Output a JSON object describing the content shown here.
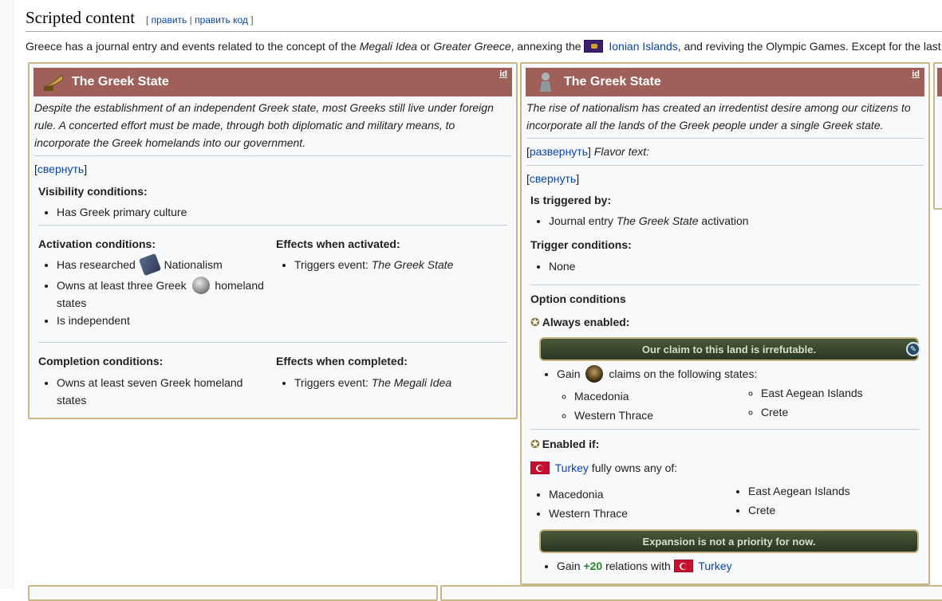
{
  "heading": {
    "title": "Scripted content",
    "edit": "править",
    "edit_code": "править код"
  },
  "intro": {
    "before": "Greece has a journal entry and events related to the concept of the ",
    "megali": "Megali Idea",
    "or": " or ",
    "greater": "Greater Greece",
    "annex": ", annexing the ",
    "ionian": "Ionian Islands",
    "after": ", and reviving the Olympic Games. Except for the last,"
  },
  "panel1": {
    "title": "The Greek State",
    "id": "id",
    "desc": "Despite the establishment of an independent Greek state, most Greeks still live under foreign rule. A concerted effort must be made, through both diplomatic and military means, to incorporate the Greek homelands into our government.",
    "collapse": "свернуть",
    "visibility_h": "Visibility conditions:",
    "visibility_items": [
      "Has Greek primary culture"
    ],
    "activation_h": "Activation conditions:",
    "act_research": "Has researched",
    "act_research_tech": "Nationalism",
    "act_owns_a": "Owns at least three Greek",
    "act_owns_b": "homeland",
    "act_owns_c": "states",
    "act_indep": "Is independent",
    "effects_act_h": "Effects when activated:",
    "effects_act_prefix": "Triggers event: ",
    "effects_act_event": "The Greek State",
    "completion_h": "Completion conditions:",
    "completion_a": "Owns at least seven Greek homeland",
    "completion_b": "states",
    "effects_comp_h": "Effects when completed:",
    "effects_comp_prefix": "Triggers event: ",
    "effects_comp_event": "The Megali Idea"
  },
  "panel2": {
    "title": "The Greek State",
    "id": "id",
    "desc": "The rise of nationalism has created an irredentist desire among our citizens to incorporate all the lands of the Greek people under a single Greek state.",
    "expand": "развернуть",
    "flavor": "Flavor text:",
    "collapse": "свернуть",
    "triggered_h": "Is triggered by:",
    "triggered_prefix": "Journal entry ",
    "triggered_je": "The Greek State",
    "triggered_suffix": " activation",
    "trigger_cond_h": "Trigger conditions:",
    "trigger_cond_item": "None",
    "option_h": "Option conditions",
    "always_h": "Always enabled:",
    "option1": "Our claim to this land is irrefutable.",
    "gain": "Gain",
    "claims_text": "claims on the following states:",
    "states_left": [
      "Macedonia",
      "Western Thrace"
    ],
    "states_right": [
      "East Aegean Islands",
      "Crete"
    ],
    "enabled_h": "Enabled if:",
    "turkey": "Turkey",
    "owns_any": " fully owns any of:",
    "owned_left": [
      "Macedonia",
      "Western Thrace"
    ],
    "owned_right": [
      "East Aegean Islands",
      "Crete"
    ],
    "option2": "Expansion is not a priority for now.",
    "gain2": "Gain ",
    "plus20": "+20",
    "relations": " relations with ",
    "turkey2": "Turkey"
  },
  "colors": {
    "title_bg": "#a0605a",
    "panel_border": "#c8b888",
    "link": "#0645ad"
  }
}
